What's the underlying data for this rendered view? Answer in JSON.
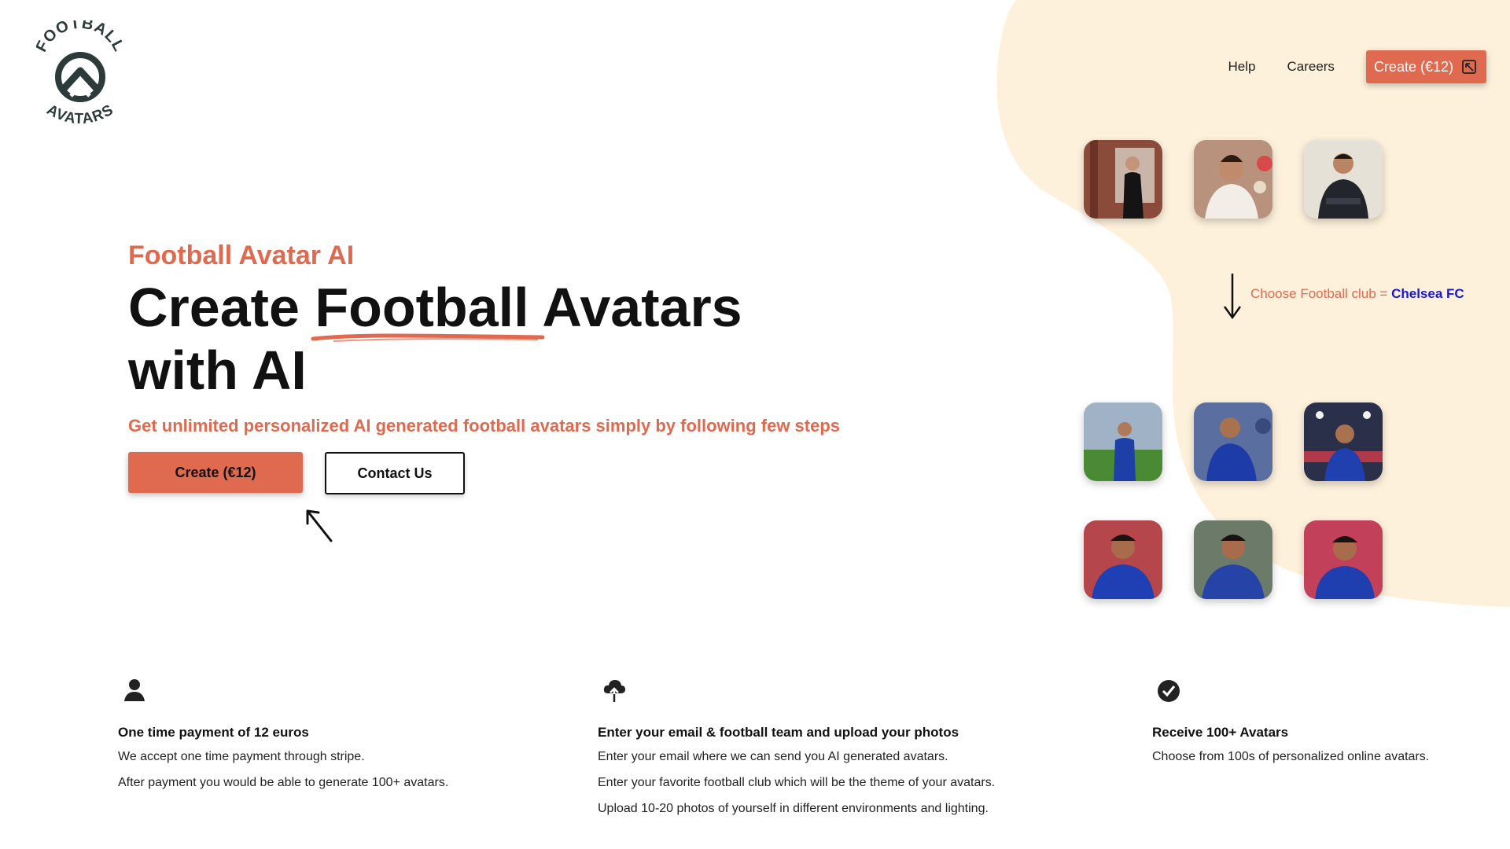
{
  "colors": {
    "accent": "#df6a50",
    "blob": "#fdf1dc",
    "club_highlight": "#1a1acc"
  },
  "logo": {
    "top_text": "FOOTBALL",
    "bottom_text": "AVATARS"
  },
  "nav": {
    "help": "Help",
    "careers": "Careers",
    "cta": "Create (€12)",
    "cta_icon": "external-link-icon"
  },
  "hero": {
    "eyebrow": "Football Avatar AI",
    "headline_part1": "Create ",
    "headline_highlight": "Football",
    "headline_part2": " Avatars",
    "headline_line2": "with AI",
    "subline": "Get unlimited personalized AI generated football avatars simply by following few steps",
    "primary_button": "Create (€12)",
    "secondary_button": "Contact Us"
  },
  "showcase": {
    "input_photos": [
      "original-photo-1",
      "original-photo-2",
      "original-photo-3"
    ],
    "club_label": "Choose Football club = ",
    "club_name": "Chelsea FC",
    "output_avatars": [
      "chelsea-avatar-1",
      "chelsea-avatar-2",
      "chelsea-avatar-3",
      "chelsea-avatar-4",
      "chelsea-avatar-5",
      "chelsea-avatar-6"
    ]
  },
  "features": [
    {
      "icon": "user-icon",
      "title": "One time payment of 12 euros",
      "lines": [
        "We accept one time payment through stripe.",
        "After payment you would be able to generate 100+ avatars."
      ]
    },
    {
      "icon": "cloud-upload-icon",
      "title": "Enter your email & football team and upload your photos",
      "lines": [
        "Enter your email where we can send you AI generated avatars.",
        "Enter your favorite football club which will be the theme of your avatars.",
        "Upload 10-20 photos of yourself in different environments and lighting."
      ]
    },
    {
      "icon": "check-circle-icon",
      "title": "Receive 100+ Avatars",
      "lines": [
        "Choose from 100s of personalized online avatars."
      ]
    }
  ]
}
